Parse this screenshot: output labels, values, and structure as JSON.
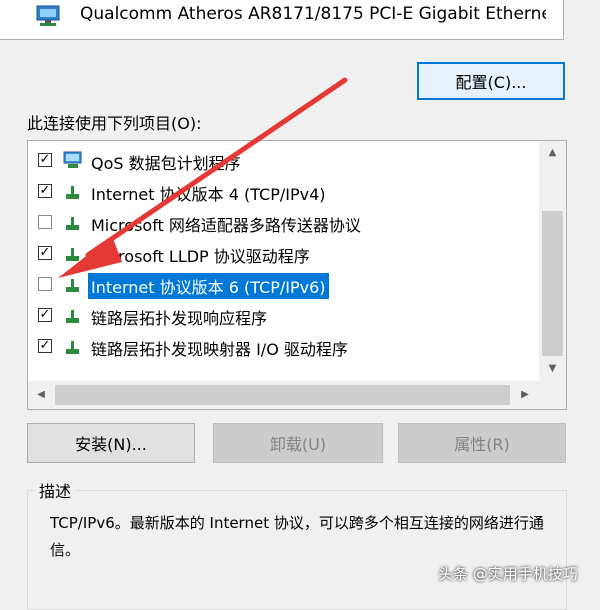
{
  "adapter": {
    "name": "Qualcomm Atheros AR8171/8175 PCI-E Gigabit Etherne"
  },
  "config_button": {
    "label": "配置(C)..."
  },
  "items_label": "此连接使用下列项目(O):",
  "items": [
    {
      "label": "QoS 数据包计划程序",
      "checked": true,
      "icon": "qos-icon"
    },
    {
      "label": "Internet 协议版本 4 (TCP/IPv4)",
      "checked": true,
      "icon": "network-protocol-icon"
    },
    {
      "label": "Microsoft 网络适配器多路传送器协议",
      "checked": false,
      "icon": "network-protocol-icon"
    },
    {
      "label": "Microsoft LLDP 协议驱动程序",
      "checked": true,
      "icon": "network-protocol-icon"
    },
    {
      "label": "Internet 协议版本 6 (TCP/IPv6)",
      "checked": false,
      "selected": true,
      "icon": "network-protocol-icon"
    },
    {
      "label": "链路层拓扑发现响应程序",
      "checked": true,
      "icon": "network-protocol-icon"
    },
    {
      "label": "链路层拓扑发现映射器 I/O 驱动程序",
      "checked": true,
      "icon": "network-protocol-icon"
    }
  ],
  "buttons": {
    "install": "安装(N)...",
    "uninstall": "卸载(U)",
    "properties": "属性(R)"
  },
  "description": {
    "title": "描述",
    "text": "TCP/IPv6。最新版本的 Internet 协议，可以跨多个相互连接的网络进行通信。"
  },
  "watermark": "头条 @实用手机技巧",
  "colors": {
    "selection": "#0078d7",
    "annotation_arrow": "#e53935",
    "focus_border": "#0078d7"
  }
}
